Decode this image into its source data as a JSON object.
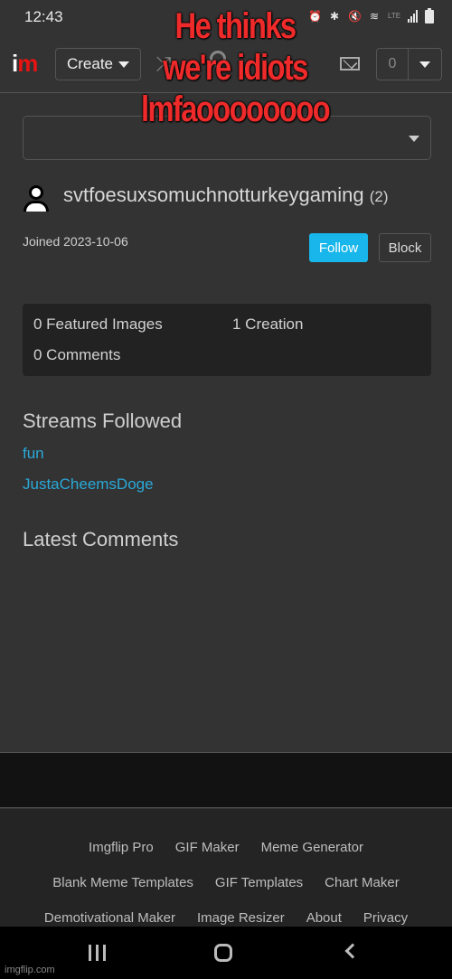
{
  "status_bar": {
    "time": "12:43",
    "icons": [
      "alarm-icon",
      "bluetooth-icon",
      "mute-icon",
      "wifi-icon",
      "volte-icon",
      "signal-icon",
      "battery-icon"
    ]
  },
  "header": {
    "logo_i": "i",
    "logo_m": "m",
    "create_label": "Create",
    "notification_count": "0"
  },
  "profile": {
    "username": "svtfoesuxsomuchnotturkeygaming",
    "points": "(2)",
    "joined": "Joined 2023-10-06",
    "follow_label": "Follow",
    "block_label": "Block"
  },
  "stats": {
    "featured": "0 Featured Images",
    "creations": "1 Creation",
    "comments": "0 Comments"
  },
  "streams": {
    "title": "Streams Followed",
    "items": [
      "fun",
      "JustaCheemsDoge"
    ]
  },
  "latest_comments": {
    "title": "Latest Comments"
  },
  "footer": {
    "rows": [
      [
        "Imgflip Pro",
        "GIF Maker",
        "Meme Generator"
      ],
      [
        "Blank Meme Templates",
        "GIF Templates",
        "Chart Maker"
      ],
      [
        "Demotivational Maker",
        "Image Resizer",
        "About",
        "Privacy"
      ]
    ]
  },
  "watermark": "imgflip.com",
  "caption": [
    "He thinks",
    "we're idiots",
    "lmfaoooooooo"
  ],
  "colors": {
    "accent": "#18b6ea",
    "link": "#2aa9d8",
    "caption": "#ee2a2a",
    "background": "#333333"
  }
}
